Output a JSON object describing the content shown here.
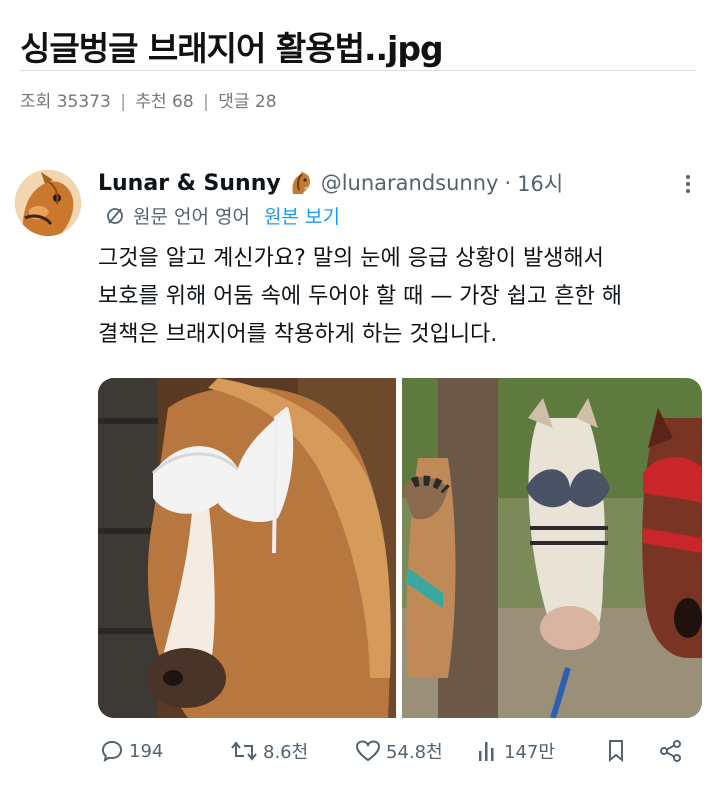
{
  "post": {
    "title": "싱글벙글 브래지어 활용법..jpg",
    "views_label": "조회",
    "views": "35373",
    "recommend_label": "추천",
    "recommend": "68",
    "comments_label": "댓글",
    "comments": "28",
    "separator": "|"
  },
  "tweet": {
    "author_name": "Lunar & Sunny",
    "author_emoji_icon": "horse-face-icon",
    "handle": "@lunarandsunny",
    "dot": "·",
    "time": "16시",
    "translate_label": "원문 언어 영어",
    "translate_link": "원본 보기",
    "text_lines": [
      "그것을 알고 계신가요? 말의 눈에 응급 상황이 발생해서",
      "보호를 위해 어둠 속에 두어야 할 때 — 가장 쉽고 흔한 해",
      "결책은 브래지어를 착용하게 하는 것입니다."
    ]
  },
  "actions": {
    "replies": "194",
    "retweets": "8.6천",
    "likes": "54.8천",
    "views": "147만"
  },
  "colors": {
    "link": "#1d9bf0",
    "muted": "#536471",
    "text": "#0f1419"
  }
}
